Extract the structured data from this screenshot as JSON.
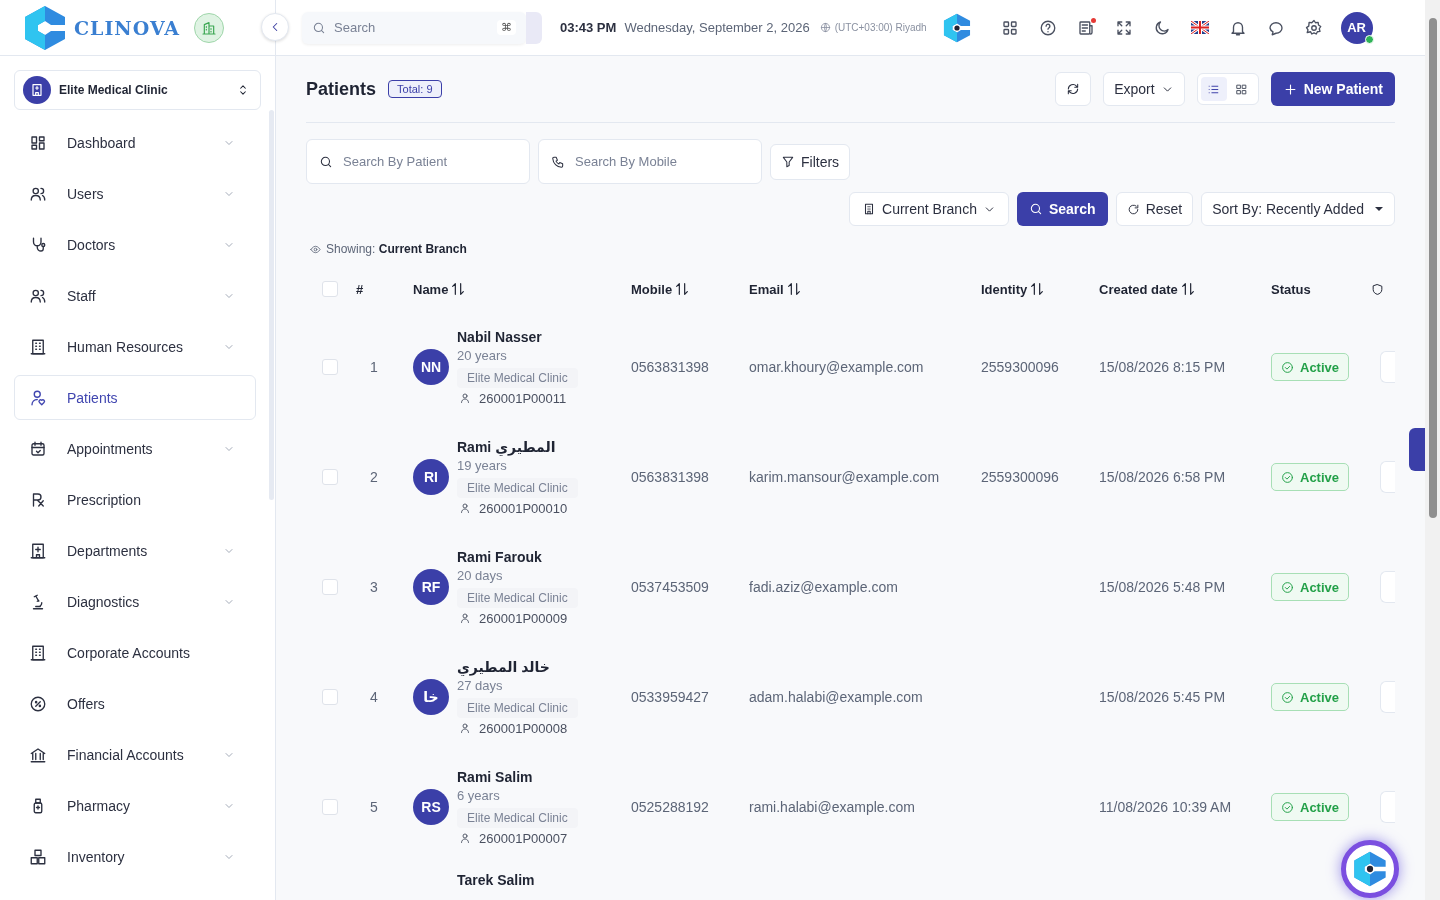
{
  "header": {
    "brand": "CLINOVA",
    "search": {
      "placeholder": "Search",
      "shortcut": "⌘"
    },
    "time": "03:43 PM",
    "date": "Wednesday, September 2, 2026",
    "timezone": "(UTC+03:00) Riyadh",
    "notification_dot": true,
    "avatar": {
      "initials": "AR",
      "online": true
    }
  },
  "sidebar": {
    "organization": "Elite Medical Clinic",
    "items": [
      {
        "label": "Dashboard",
        "expandable": true,
        "selected": false
      },
      {
        "label": "Users",
        "expandable": true,
        "selected": false
      },
      {
        "label": "Doctors",
        "expandable": true,
        "selected": false
      },
      {
        "label": "Staff",
        "expandable": true,
        "selected": false
      },
      {
        "label": "Human Resources",
        "expandable": true,
        "selected": false
      },
      {
        "label": "Patients",
        "expandable": false,
        "selected": true
      },
      {
        "label": "Appointments",
        "expandable": true,
        "selected": false
      },
      {
        "label": "Prescription",
        "expandable": false,
        "selected": false
      },
      {
        "label": "Departments",
        "expandable": true,
        "selected": false
      },
      {
        "label": "Diagnostics",
        "expandable": true,
        "selected": false
      },
      {
        "label": "Corporate Accounts",
        "expandable": false,
        "selected": false
      },
      {
        "label": "Offers",
        "expandable": false,
        "selected": false
      },
      {
        "label": "Financial Accounts",
        "expandable": true,
        "selected": false
      },
      {
        "label": "Pharmacy",
        "expandable": true,
        "selected": false
      },
      {
        "label": "Inventory",
        "expandable": true,
        "selected": false
      }
    ]
  },
  "page": {
    "title": "Patients",
    "total": "Total: 9",
    "export": "Export",
    "views": [
      {
        "kind": "list",
        "selected": true
      },
      {
        "kind": "grid",
        "selected": false
      }
    ],
    "new_button": "New Patient"
  },
  "filters": {
    "patient_search": {
      "placeholder": "Search By Patient"
    },
    "mobile_search": {
      "placeholder": "Search By Mobile"
    },
    "filters_button": "Filters",
    "branch": "Current Branch",
    "search_button": "Search",
    "reset_button": "Reset",
    "sort_label": "Sort By:",
    "sort_value": "Recently Added"
  },
  "showing": {
    "label": "Showing:",
    "value": "Current Branch"
  },
  "table": {
    "select_all_checked": false,
    "columns": [
      {
        "label": "#",
        "sortable": false
      },
      {
        "label": "Name",
        "sortable": true
      },
      {
        "label": "Mobile",
        "sortable": true
      },
      {
        "label": "Email",
        "sortable": true
      },
      {
        "label": "Identity",
        "sortable": true
      },
      {
        "label": "Created date",
        "sortable": true
      },
      {
        "label": "Status",
        "sortable": false
      }
    ],
    "rows": [
      {
        "checked": false,
        "number": "1",
        "initials": "NN",
        "name": "Nabil Nasser",
        "age": "20 years",
        "clinic": "Elite Medical Clinic",
        "file": "260001P00011",
        "mobile": "0563831398",
        "email": "omar.khoury@example.com",
        "identity": "2559300096",
        "created": "15/08/2026 8:15 PM",
        "status": "Active"
      },
      {
        "checked": false,
        "number": "2",
        "initials": "RI",
        "name": "Rami المطيري",
        "age": "19 years",
        "clinic": "Elite Medical Clinic",
        "file": "260001P00010",
        "mobile": "0563831398",
        "email": "karim.mansour@example.com",
        "identity": "2559300096",
        "created": "15/08/2026 6:58 PM",
        "status": "Active"
      },
      {
        "checked": false,
        "number": "3",
        "initials": "RF",
        "name": "Rami Farouk",
        "age": "20 days",
        "clinic": "Elite Medical Clinic",
        "file": "260001P00009",
        "mobile": "0537453509",
        "email": "fadi.aziz@example.com",
        "created": "15/08/2026 5:48 PM",
        "status": "Active"
      },
      {
        "checked": false,
        "number": "4",
        "initials": "خا",
        "name": "خالد المطيري",
        "age": "27 days",
        "clinic": "Elite Medical Clinic",
        "file": "260001P00008",
        "mobile": "0533959427",
        "email": "adam.halabi@example.com",
        "created": "15/08/2026 5:45 PM",
        "status": "Active"
      },
      {
        "checked": false,
        "number": "5",
        "initials": "RS",
        "name": "Rami Salim",
        "age": "6 years",
        "clinic": "Elite Medical Clinic",
        "file": "260001P00007",
        "mobile": "0525288192",
        "email": "rami.halabi@example.com",
        "created": "11/08/2026 10:39 AM",
        "status": "Active"
      },
      {
        "name": "Tarek Salim"
      }
    ]
  }
}
